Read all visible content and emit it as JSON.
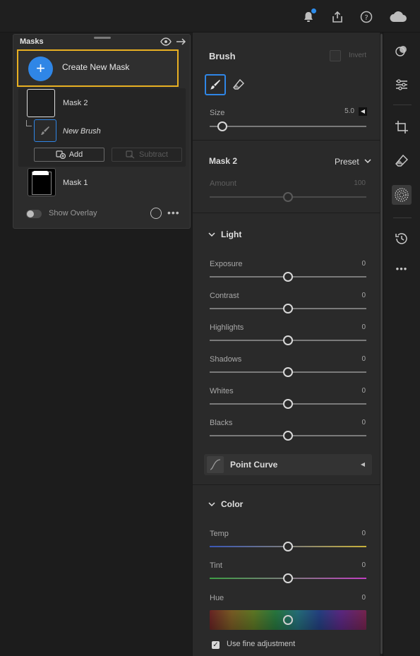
{
  "topbar": {
    "icons": [
      "bell-icon",
      "share-icon",
      "help-icon",
      "cloud-icon"
    ]
  },
  "masks_panel": {
    "title": "Masks",
    "create_label": "Create New Mask",
    "masks": [
      {
        "name": "Mask 2",
        "child": "New Brush"
      },
      {
        "name": "Mask 1"
      }
    ],
    "add_label": "Add",
    "subtract_label": "Subtract",
    "overlay_label": "Show Overlay"
  },
  "brush": {
    "title": "Brush",
    "invert_label": "Invert",
    "size_label": "Size",
    "size_value": "5.0",
    "size_fraction": 0.08
  },
  "mask_section": {
    "title": "Mask 2",
    "preset_label": "Preset",
    "amount_label": "Amount",
    "amount_value": "100",
    "amount_fraction": 0.5
  },
  "light": {
    "title": "Light",
    "sliders": [
      {
        "label": "Exposure",
        "value": "0",
        "fraction": 0.5
      },
      {
        "label": "Contrast",
        "value": "0",
        "fraction": 0.5
      },
      {
        "label": "Highlights",
        "value": "0",
        "fraction": 0.5
      },
      {
        "label": "Shadows",
        "value": "0",
        "fraction": 0.5
      },
      {
        "label": "Whites",
        "value": "0",
        "fraction": 0.5
      },
      {
        "label": "Blacks",
        "value": "0",
        "fraction": 0.5
      }
    ],
    "point_curve_label": "Point Curve"
  },
  "color": {
    "title": "Color",
    "temp_label": "Temp",
    "temp_value": "0",
    "tint_label": "Tint",
    "tint_value": "0",
    "hue_label": "Hue",
    "hue_value": "0",
    "fine_adjust_label": "Use fine adjustment",
    "fine_adjust_checked": true
  },
  "colors": {
    "accent": "#2f86e6",
    "highlight": "#e8b022"
  }
}
